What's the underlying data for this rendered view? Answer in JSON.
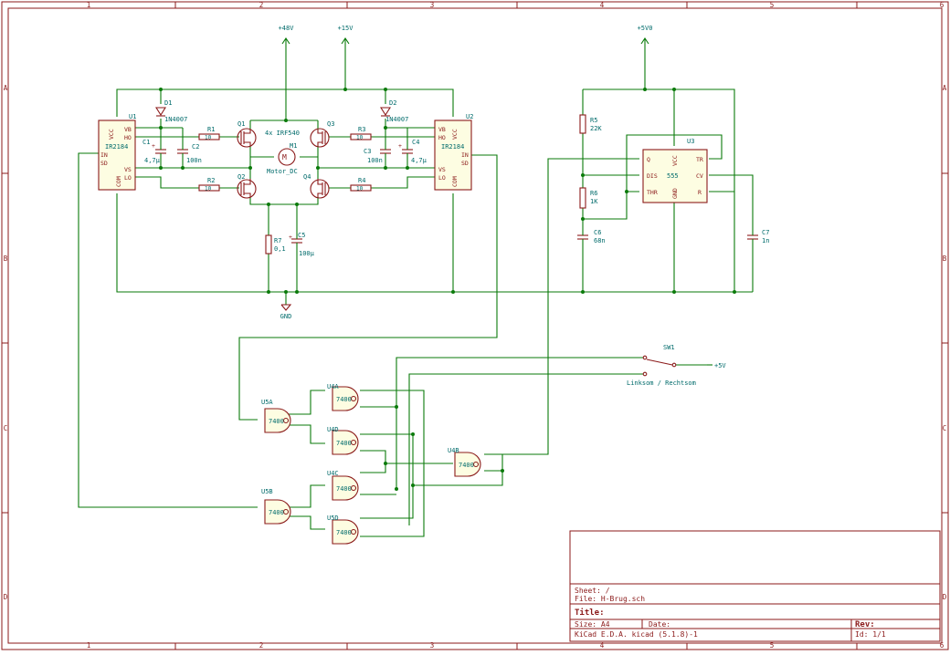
{
  "border": {
    "columns": [
      "1",
      "2",
      "3",
      "4",
      "5",
      "6"
    ],
    "rows": [
      "A",
      "B",
      "C",
      "D"
    ]
  },
  "power": {
    "p48": "+48V",
    "p15": "+15V",
    "p5v0": "+5V0",
    "gnd": "GND",
    "p5v": "+5V"
  },
  "components": {
    "u1": {
      "ref": "U1",
      "value": "IR2184",
      "pins": [
        "VB",
        "HO",
        "VCC",
        "IN",
        "SD",
        "VS",
        "LO",
        "COM"
      ]
    },
    "u2": {
      "ref": "U2",
      "value": "IR2184",
      "pins": [
        "VB",
        "HO",
        "VCC",
        "IN",
        "SD",
        "VS",
        "LO",
        "COM"
      ]
    },
    "u3": {
      "ref": "U3",
      "value": "555",
      "pins": [
        "Q",
        "DIS",
        "THR",
        "TR",
        "CV",
        "R",
        "VCC",
        "GND"
      ]
    },
    "d1": {
      "ref": "D1",
      "value": "1N4007"
    },
    "d2": {
      "ref": "D2",
      "value": "1N4007"
    },
    "r1": {
      "ref": "R1",
      "value": "10"
    },
    "r2": {
      "ref": "R2",
      "value": "10"
    },
    "r3": {
      "ref": "R3",
      "value": "10"
    },
    "r4": {
      "ref": "R4",
      "value": "10"
    },
    "r5": {
      "ref": "R5",
      "value": "22K"
    },
    "r6": {
      "ref": "R6",
      "value": "1K"
    },
    "r7": {
      "ref": "R7",
      "value": "0,1"
    },
    "c1": {
      "ref": "C1",
      "value": "4,7µ"
    },
    "c2": {
      "ref": "C2",
      "value": "100n"
    },
    "c3": {
      "ref": "C3",
      "value": "100n"
    },
    "c4": {
      "ref": "C4",
      "value": "4,7µ"
    },
    "c5": {
      "ref": "C5",
      "value": "100µ"
    },
    "c6": {
      "ref": "C6",
      "value": "68n"
    },
    "c7": {
      "ref": "C7",
      "value": "1n"
    },
    "q1": {
      "ref": "Q1"
    },
    "q2": {
      "ref": "Q2"
    },
    "q3": {
      "ref": "Q3"
    },
    "q4": {
      "ref": "Q4"
    },
    "qnote": "4x IRF540",
    "m1": {
      "ref": "M1",
      "value": "Motor_DC"
    },
    "sw1": {
      "ref": "SW1",
      "value": "Linksom / Rechtsom"
    },
    "u4a": {
      "ref": "U4A",
      "value": "7400"
    },
    "u4b": {
      "ref": "U4B",
      "value": "7400"
    },
    "u4c": {
      "ref": "U4C",
      "value": "7400"
    },
    "u4d": {
      "ref": "U4D",
      "value": "7400"
    },
    "u5a": {
      "ref": "U5A",
      "value": "7400"
    },
    "u5b": {
      "ref": "U5B",
      "value": "7400"
    },
    "u5d": {
      "ref": "U5D",
      "value": "7400"
    }
  },
  "title_block": {
    "sheet": "Sheet: /",
    "file": "File: H-Brug.sch",
    "title": "Title:",
    "size": "Size: A4",
    "date": "Date:",
    "rev": "Rev:",
    "tool": "KiCad E.D.A.  kicad (5.1.8)-1",
    "id": "Id: 1/1"
  }
}
